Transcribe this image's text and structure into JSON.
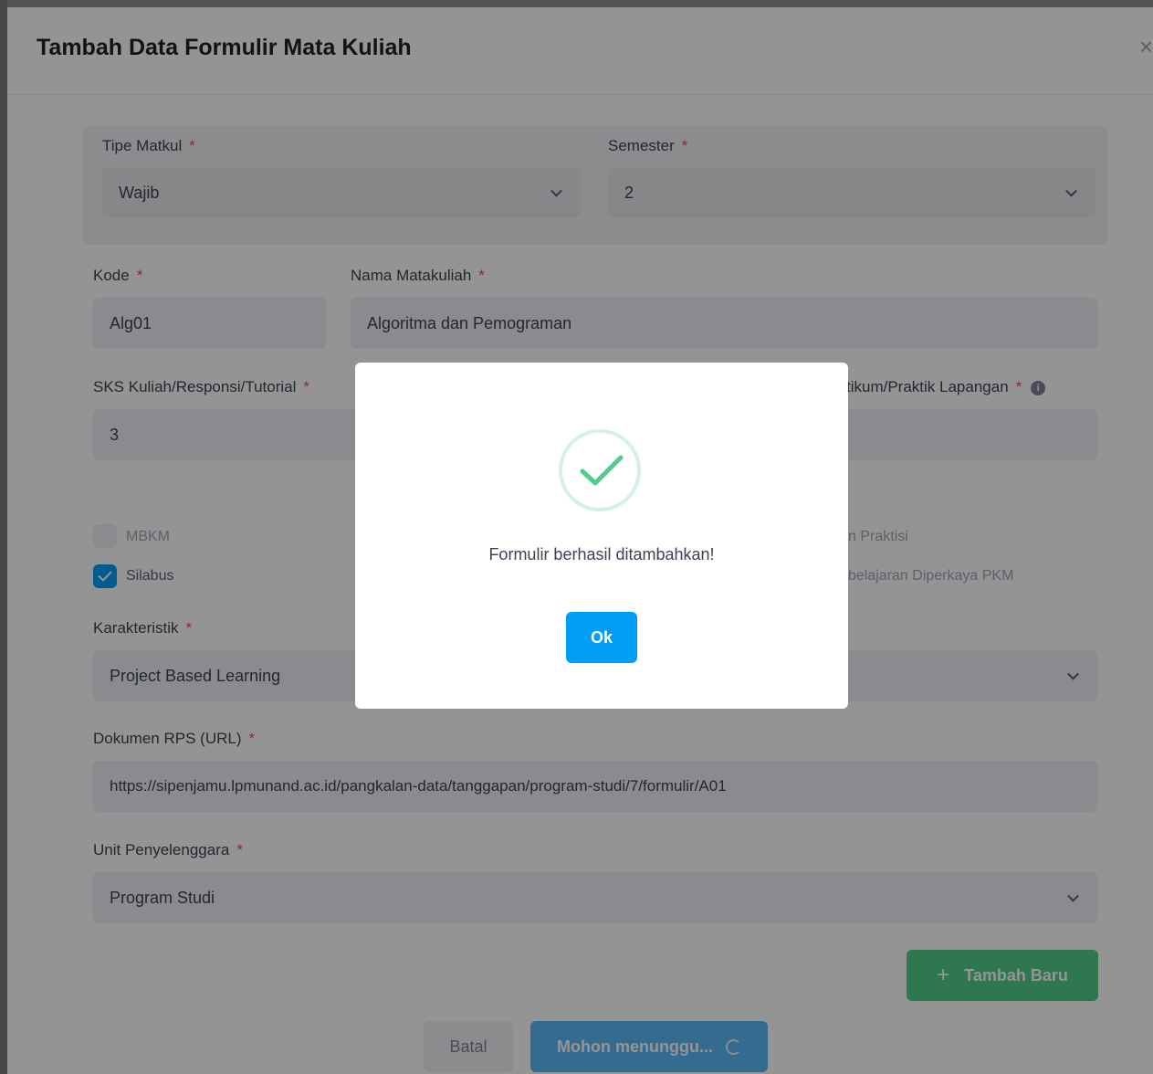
{
  "modal": {
    "title": "Tambah Data Formulir Mata Kuliah",
    "close_glyph": "×"
  },
  "form": {
    "tipe_matkul": {
      "label": "Tipe Matkul",
      "value": "Wajib"
    },
    "semester": {
      "label": "Semester",
      "value": "2"
    },
    "kode": {
      "label": "Kode",
      "value": "Alg01"
    },
    "nama": {
      "label": "Nama Matakuliah",
      "value": "Algoritma dan Pemograman"
    },
    "sks_kuliah": {
      "label": "SKS Kuliah/Responsi/Tutorial",
      "value": "3"
    },
    "sks_praktikum": {
      "label_fragment": "tikum/Praktik Lapangan"
    },
    "required_marker": "*",
    "checkboxes": [
      {
        "label": "MBKM",
        "checked": false
      },
      {
        "label": "Silabus",
        "checked": true
      },
      {
        "label_fragment": "n Praktisi"
      },
      {
        "label_fragment": "belajaran Diperkaya PKM"
      }
    ],
    "karakteristik": {
      "label": "Karakteristik",
      "value": "Project Based Learning"
    },
    "dokumen_rps": {
      "label": "Dokumen RPS (URL)",
      "value": "https://sipenjamu.lpmunand.ac.id/pangkalan-data/tanggapan/program-studi/7/formulir/A01"
    },
    "unit": {
      "label": "Unit Penyelenggara",
      "value": "Program Studi"
    }
  },
  "buttons": {
    "tambah_baru": "Tambah Baru",
    "batal": "Batal",
    "submit_loading": "Mohon menunggu..."
  },
  "dialog": {
    "message": "Formulir berhasil ditambahkan!",
    "ok": "Ok",
    "icon": "check-icon"
  },
  "colors": {
    "primary": "#009ef7",
    "success": "#50cd89",
    "danger": "#f1416c"
  }
}
